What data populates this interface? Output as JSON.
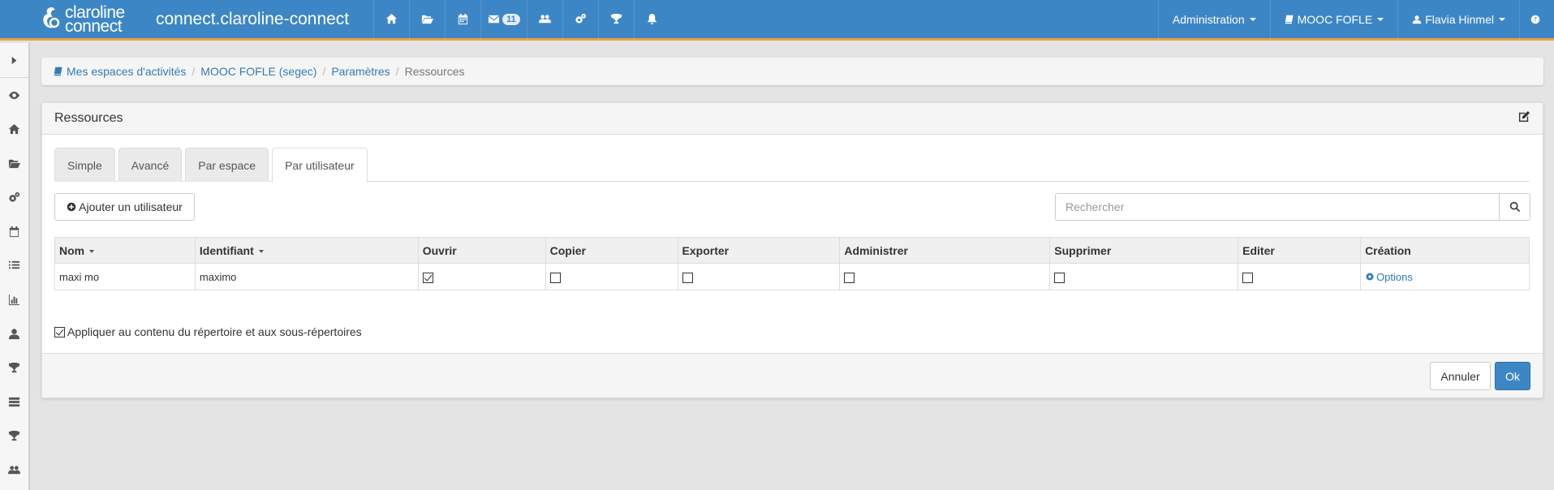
{
  "app": {
    "logo_line1": "claroline",
    "logo_line2": "connect",
    "site_title": "connect.claroline-connect"
  },
  "navbar": {
    "icons": [
      "home-icon",
      "folder-open-icon",
      "calendar-icon",
      "envelope-icon",
      "users-icon",
      "cogs-icon",
      "trophy-icon",
      "bell-icon"
    ],
    "mail_badge": "11",
    "admin_menu": "Administration",
    "workspace_menu": "MOOC FOFLE",
    "user_menu": "Flavia Hinmel"
  },
  "sidebar": {
    "items": [
      "eye-icon",
      "home-icon",
      "folder-open-icon",
      "cogs-icon",
      "calendar-icon",
      "list-icon",
      "bar-chart-icon",
      "user-icon",
      "trophy-icon",
      "tasks-icon",
      "trophy-icon",
      "users-icon"
    ]
  },
  "breadcrumb": {
    "items": [
      "Mes espaces d'activités",
      "MOOC FOFLE (segec)",
      "Paramètres"
    ],
    "active": "Ressources"
  },
  "panel": {
    "title": "Ressources",
    "tabs": [
      "Simple",
      "Avancé",
      "Par espace",
      "Par utilisateur"
    ],
    "active_tab": "Par utilisateur",
    "add_user_label": "Ajouter un utilisateur",
    "search_placeholder": "Rechercher",
    "table": {
      "columns": [
        "Nom",
        "Identifiant",
        "Ouvrir",
        "Copier",
        "Exporter",
        "Administrer",
        "Supprimer",
        "Editer",
        "Création"
      ],
      "rows": [
        {
          "nom": "maxi mo",
          "identifiant": "maximo",
          "ouvrir": true,
          "copier": false,
          "exporter": false,
          "administrer": false,
          "supprimer": false,
          "editer": false,
          "creation_label": "Options"
        }
      ]
    },
    "apply_label": "Appliquer au contenu du répertoire et aux sous-répertoires",
    "apply_checked": true,
    "cancel_label": "Annuler",
    "ok_label": "Ok"
  },
  "colors": {
    "navbar": "#3d86c6",
    "navbar_border": "#e8a23b",
    "link": "#337ab7",
    "primary_button": "#3d86c6"
  }
}
